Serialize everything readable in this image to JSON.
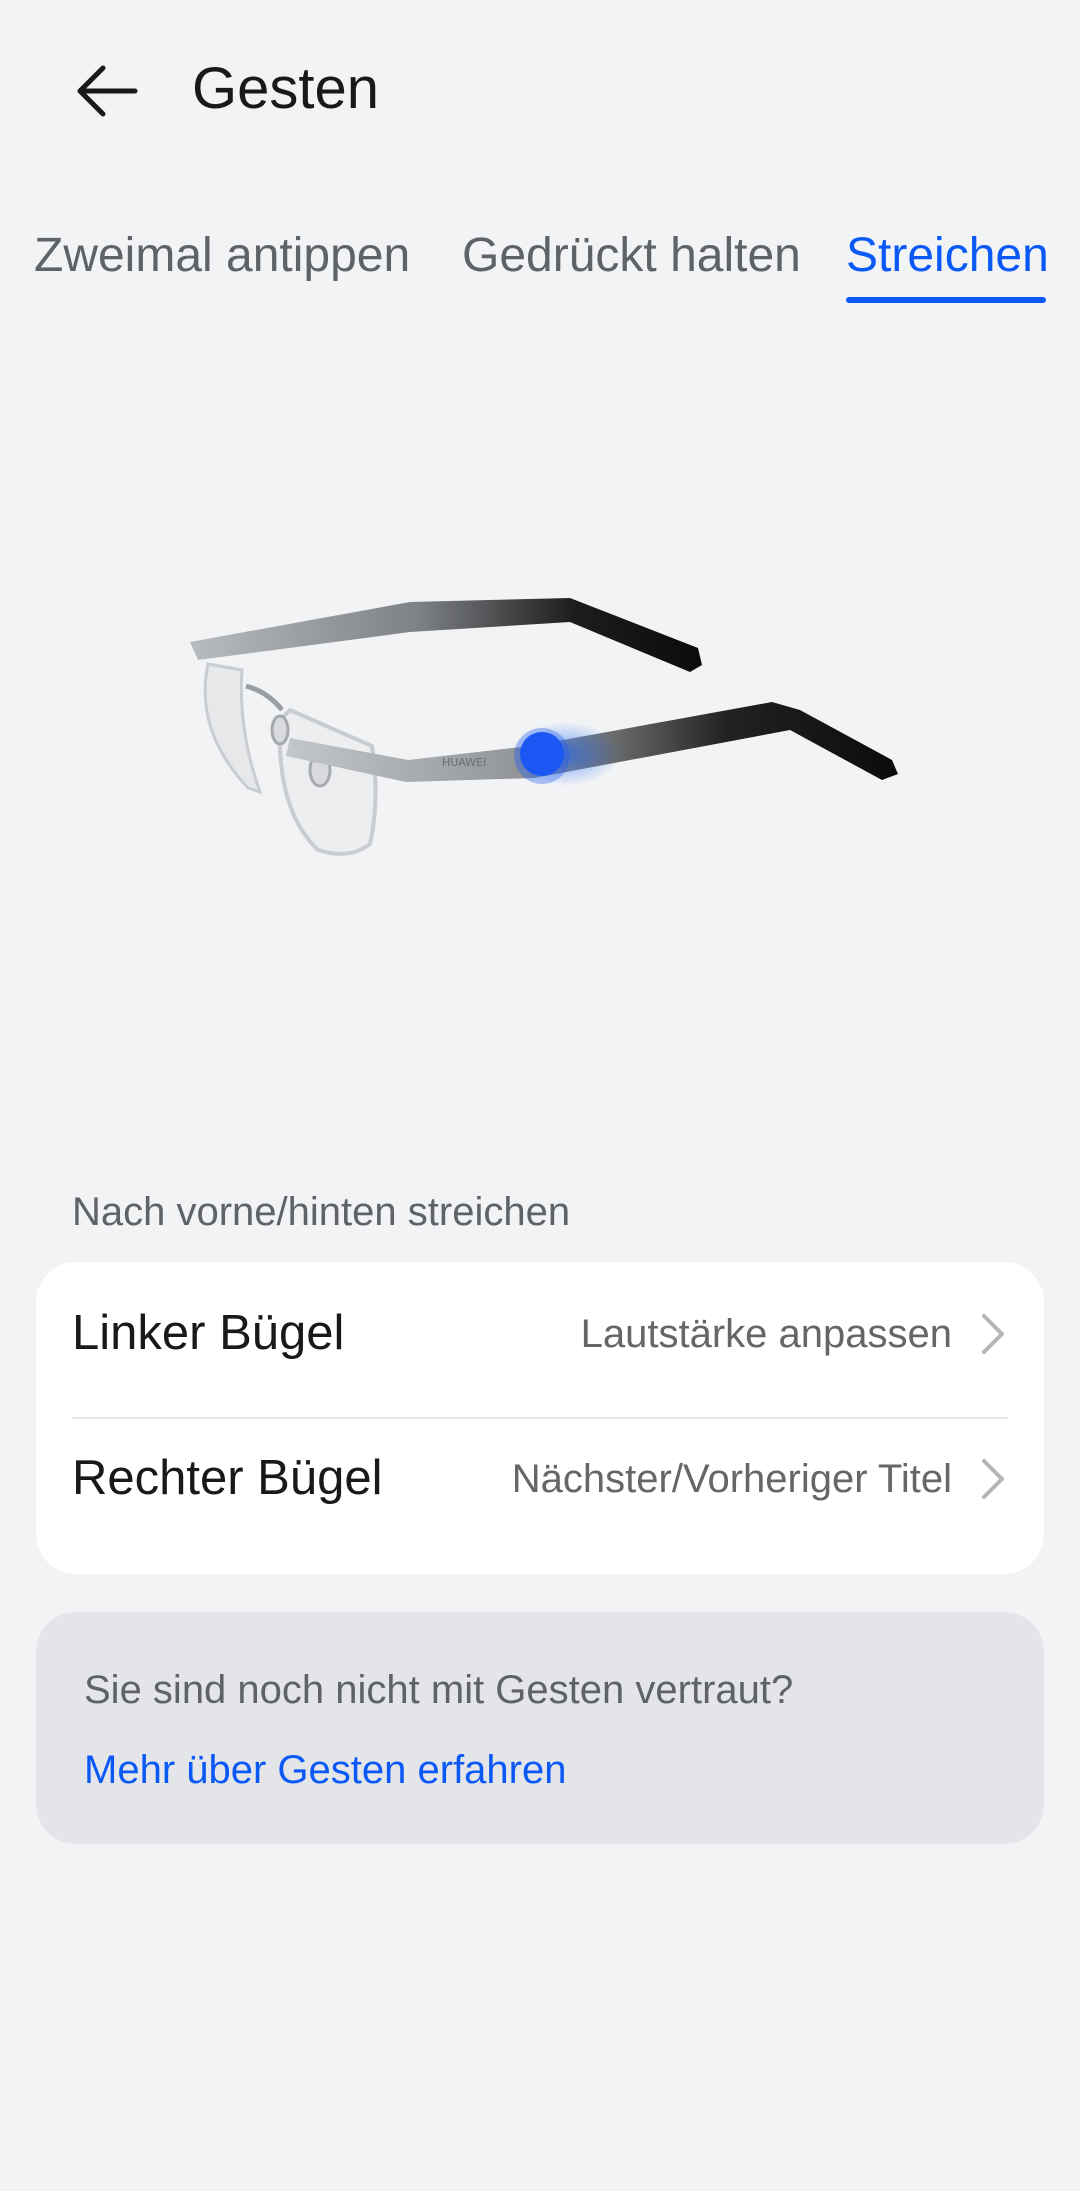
{
  "header": {
    "title": "Gesten",
    "back_icon": "arrow-left-icon"
  },
  "tabs": [
    {
      "label": "Zweimal antippen",
      "active": false
    },
    {
      "label": "Gedrückt halten",
      "active": false
    },
    {
      "label": "Streichen",
      "active": true
    }
  ],
  "section": {
    "label": "Nach vorne/hinten streichen"
  },
  "settings": [
    {
      "label": "Linker Bügel",
      "value": "Lautstärke anpassen",
      "icon": "chevron-right-icon"
    },
    {
      "label": "Rechter Bügel",
      "value": "Nächster/Vorheriger Titel",
      "icon": "chevron-right-icon"
    }
  ],
  "info": {
    "text": "Sie sind noch nicht mit Gesten vertraut?",
    "link": "Mehr über Gesten erfahren"
  },
  "colors": {
    "accent": "#0a59f7",
    "background": "#f1f3f5",
    "card": "#ffffff",
    "info_card": "#e4e5e8"
  }
}
